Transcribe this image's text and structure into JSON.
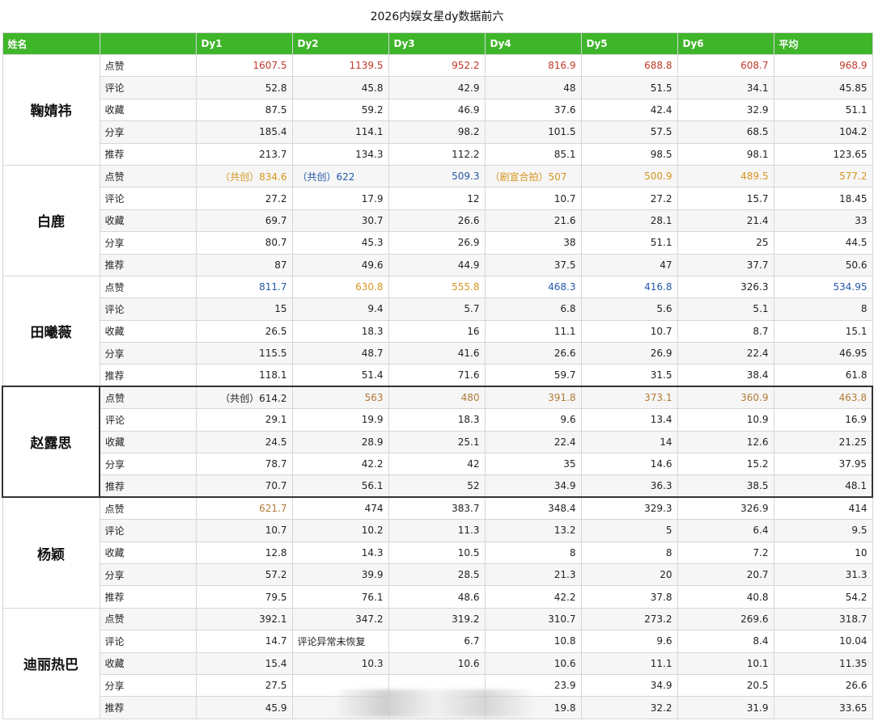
{
  "title": "2026内娱女星dy数据前六",
  "header": {
    "name_col": "姓名",
    "metric_col": "",
    "day_cols": [
      "Dy1",
      "Dy2",
      "Dy3",
      "Dy4",
      "Dy5",
      "Dy6",
      "平均"
    ]
  },
  "colors": {
    "header_bg": "#3fb52a",
    "red": "#c0392b",
    "orange": "#d6951f",
    "blue": "#2457a8",
    "brown": "#b07a35"
  },
  "groups": [
    {
      "name": "鞠婧祎",
      "rows": [
        {
          "metric": "点赞",
          "cells": [
            {
              "t": "1607.5",
              "c": "red"
            },
            {
              "t": "1139.5",
              "c": "red"
            },
            {
              "t": "952.2",
              "c": "red"
            },
            {
              "t": "816.9",
              "c": "red"
            },
            {
              "t": "688.8",
              "c": "red"
            },
            {
              "t": "608.7",
              "c": "red"
            },
            {
              "t": "968.9",
              "c": "red"
            }
          ]
        },
        {
          "metric": "评论",
          "cells": [
            {
              "t": "52.8"
            },
            {
              "t": "45.8"
            },
            {
              "t": "42.9"
            },
            {
              "t": "48"
            },
            {
              "t": "51.5"
            },
            {
              "t": "34.1"
            },
            {
              "t": "45.85"
            }
          ]
        },
        {
          "metric": "收藏",
          "cells": [
            {
              "t": "87.5"
            },
            {
              "t": "59.2"
            },
            {
              "t": "46.9"
            },
            {
              "t": "37.6"
            },
            {
              "t": "42.4"
            },
            {
              "t": "32.9"
            },
            {
              "t": "51.1"
            }
          ]
        },
        {
          "metric": "分享",
          "cells": [
            {
              "t": "185.4"
            },
            {
              "t": "114.1"
            },
            {
              "t": "98.2"
            },
            {
              "t": "101.5"
            },
            {
              "t": "57.5"
            },
            {
              "t": "68.5"
            },
            {
              "t": "104.2"
            }
          ]
        },
        {
          "metric": "推荐",
          "cells": [
            {
              "t": "213.7"
            },
            {
              "t": "134.3"
            },
            {
              "t": "112.2"
            },
            {
              "t": "85.1"
            },
            {
              "t": "98.5"
            },
            {
              "t": "98.1"
            },
            {
              "t": "123.65"
            }
          ]
        }
      ]
    },
    {
      "name": "白鹿",
      "rows": [
        {
          "metric": "点赞",
          "cells": [
            {
              "t": "（共创）834.6",
              "c": "orange"
            },
            {
              "t": "（共创）622",
              "c": "blue",
              "a": "left"
            },
            {
              "t": "509.3",
              "c": "blue"
            },
            {
              "t": "（剧宣合拍）507",
              "c": "orange",
              "a": "left"
            },
            {
              "t": "500.9",
              "c": "orange"
            },
            {
              "t": "489.5",
              "c": "orange"
            },
            {
              "t": "577.2",
              "c": "orange"
            }
          ]
        },
        {
          "metric": "评论",
          "cells": [
            {
              "t": "27.2"
            },
            {
              "t": "17.9"
            },
            {
              "t": "12"
            },
            {
              "t": "10.7"
            },
            {
              "t": "27.2"
            },
            {
              "t": "15.7"
            },
            {
              "t": "18.45"
            }
          ]
        },
        {
          "metric": "收藏",
          "cells": [
            {
              "t": "69.7"
            },
            {
              "t": "30.7"
            },
            {
              "t": "26.6"
            },
            {
              "t": "21.6"
            },
            {
              "t": "28.1"
            },
            {
              "t": "21.4"
            },
            {
              "t": "33"
            }
          ]
        },
        {
          "metric": "分享",
          "cells": [
            {
              "t": "80.7"
            },
            {
              "t": "45.3"
            },
            {
              "t": "26.9"
            },
            {
              "t": "38"
            },
            {
              "t": "51.1"
            },
            {
              "t": "25"
            },
            {
              "t": "44.5"
            }
          ]
        },
        {
          "metric": "推荐",
          "cells": [
            {
              "t": "87"
            },
            {
              "t": "49.6"
            },
            {
              "t": "44.9"
            },
            {
              "t": "37.5"
            },
            {
              "t": "47"
            },
            {
              "t": "37.7"
            },
            {
              "t": "50.6"
            }
          ]
        }
      ]
    },
    {
      "name": "田曦薇",
      "rows": [
        {
          "metric": "点赞",
          "cells": [
            {
              "t": "811.7",
              "c": "blue"
            },
            {
              "t": "630.8",
              "c": "orange"
            },
            {
              "t": "555.8",
              "c": "orange"
            },
            {
              "t": "468.3",
              "c": "blue"
            },
            {
              "t": "416.8",
              "c": "blue"
            },
            {
              "t": "326.3"
            },
            {
              "t": "534.95",
              "c": "blue"
            }
          ]
        },
        {
          "metric": "评论",
          "cells": [
            {
              "t": "15"
            },
            {
              "t": "9.4"
            },
            {
              "t": "5.7"
            },
            {
              "t": "6.8"
            },
            {
              "t": "5.6"
            },
            {
              "t": "5.1"
            },
            {
              "t": "8"
            }
          ]
        },
        {
          "metric": "收藏",
          "cells": [
            {
              "t": "26.5"
            },
            {
              "t": "18.3"
            },
            {
              "t": "16"
            },
            {
              "t": "11.1"
            },
            {
              "t": "10.7"
            },
            {
              "t": "8.7"
            },
            {
              "t": "15.1"
            }
          ]
        },
        {
          "metric": "分享",
          "cells": [
            {
              "t": "115.5"
            },
            {
              "t": "48.7"
            },
            {
              "t": "41.6"
            },
            {
              "t": "26.6"
            },
            {
              "t": "26.9"
            },
            {
              "t": "22.4"
            },
            {
              "t": "46.95"
            }
          ]
        },
        {
          "metric": "推荐",
          "cells": [
            {
              "t": "118.1"
            },
            {
              "t": "51.4"
            },
            {
              "t": "71.6"
            },
            {
              "t": "59.7"
            },
            {
              "t": "31.5"
            },
            {
              "t": "38.4"
            },
            {
              "t": "61.8"
            }
          ]
        }
      ]
    },
    {
      "name": "赵露思",
      "boxed": true,
      "rows": [
        {
          "metric": "点赞",
          "cells": [
            {
              "t": "（共创）614.2"
            },
            {
              "t": "563",
              "c": "brown"
            },
            {
              "t": "480",
              "c": "brown"
            },
            {
              "t": "391.8",
              "c": "brown"
            },
            {
              "t": "373.1",
              "c": "brown"
            },
            {
              "t": "360.9",
              "c": "brown"
            },
            {
              "t": "463.8",
              "c": "brown"
            }
          ]
        },
        {
          "metric": "评论",
          "cells": [
            {
              "t": "29.1"
            },
            {
              "t": "19.9"
            },
            {
              "t": "18.3"
            },
            {
              "t": "9.6"
            },
            {
              "t": "13.4"
            },
            {
              "t": "10.9"
            },
            {
              "t": "16.9"
            }
          ]
        },
        {
          "metric": "收藏",
          "cells": [
            {
              "t": "24.5"
            },
            {
              "t": "28.9"
            },
            {
              "t": "25.1"
            },
            {
              "t": "22.4"
            },
            {
              "t": "14"
            },
            {
              "t": "12.6"
            },
            {
              "t": "21.25"
            }
          ]
        },
        {
          "metric": "分享",
          "cells": [
            {
              "t": "78.7"
            },
            {
              "t": "42.2"
            },
            {
              "t": "42"
            },
            {
              "t": "35"
            },
            {
              "t": "14.6"
            },
            {
              "t": "15.2"
            },
            {
              "t": "37.95"
            }
          ]
        },
        {
          "metric": "推荐",
          "cells": [
            {
              "t": "70.7"
            },
            {
              "t": "56.1"
            },
            {
              "t": "52"
            },
            {
              "t": "34.9"
            },
            {
              "t": "36.3"
            },
            {
              "t": "38.5"
            },
            {
              "t": "48.1"
            }
          ]
        }
      ]
    },
    {
      "name": "杨颖",
      "rows": [
        {
          "metric": "点赞",
          "cells": [
            {
              "t": "621.7",
              "c": "brown"
            },
            {
              "t": "474"
            },
            {
              "t": "383.7"
            },
            {
              "t": "348.4"
            },
            {
              "t": "329.3"
            },
            {
              "t": "326.9"
            },
            {
              "t": "414"
            }
          ]
        },
        {
          "metric": "评论",
          "cells": [
            {
              "t": "10.7"
            },
            {
              "t": "10.2"
            },
            {
              "t": "11.3"
            },
            {
              "t": "13.2"
            },
            {
              "t": "5"
            },
            {
              "t": "6.4"
            },
            {
              "t": "9.5"
            }
          ]
        },
        {
          "metric": "收藏",
          "cells": [
            {
              "t": "12.8"
            },
            {
              "t": "14.3"
            },
            {
              "t": "10.5"
            },
            {
              "t": "8"
            },
            {
              "t": "8"
            },
            {
              "t": "7.2"
            },
            {
              "t": "10"
            }
          ]
        },
        {
          "metric": "分享",
          "cells": [
            {
              "t": "57.2"
            },
            {
              "t": "39.9"
            },
            {
              "t": "28.5"
            },
            {
              "t": "21.3"
            },
            {
              "t": "20"
            },
            {
              "t": "20.7"
            },
            {
              "t": "31.3"
            }
          ]
        },
        {
          "metric": "推荐",
          "cells": [
            {
              "t": "79.5"
            },
            {
              "t": "76.1"
            },
            {
              "t": "48.6"
            },
            {
              "t": "42.2"
            },
            {
              "t": "37.8"
            },
            {
              "t": "40.8"
            },
            {
              "t": "54.2"
            }
          ]
        }
      ]
    },
    {
      "name": "迪丽热巴",
      "rows": [
        {
          "metric": "点赞",
          "cells": [
            {
              "t": "392.1"
            },
            {
              "t": "347.2"
            },
            {
              "t": "319.2"
            },
            {
              "t": "310.7"
            },
            {
              "t": "273.2"
            },
            {
              "t": "269.6"
            },
            {
              "t": "318.7"
            }
          ]
        },
        {
          "metric": "评论",
          "cells": [
            {
              "t": "14.7"
            },
            {
              "t": "评论异常未恢复",
              "a": "left"
            },
            {
              "t": "6.7"
            },
            {
              "t": "10.8"
            },
            {
              "t": "9.6"
            },
            {
              "t": "8.4"
            },
            {
              "t": "10.04"
            }
          ]
        },
        {
          "metric": "收藏",
          "cells": [
            {
              "t": "15.4"
            },
            {
              "t": "10.3"
            },
            {
              "t": "10.6"
            },
            {
              "t": "10.6"
            },
            {
              "t": "11.1"
            },
            {
              "t": "10.1"
            },
            {
              "t": "11.35"
            }
          ]
        },
        {
          "metric": "分享",
          "cells": [
            {
              "t": "27.5"
            },
            {
              "t": ""
            },
            {
              "t": ""
            },
            {
              "t": "23.9"
            },
            {
              "t": "34.9"
            },
            {
              "t": "20.5"
            },
            {
              "t": "26.6"
            }
          ]
        },
        {
          "metric": "推荐",
          "cells": [
            {
              "t": "45.9"
            },
            {
              "t": ""
            },
            {
              "t": ""
            },
            {
              "t": "19.8"
            },
            {
              "t": "32.2"
            },
            {
              "t": "31.9"
            },
            {
              "t": "33.65"
            }
          ]
        }
      ]
    }
  ]
}
